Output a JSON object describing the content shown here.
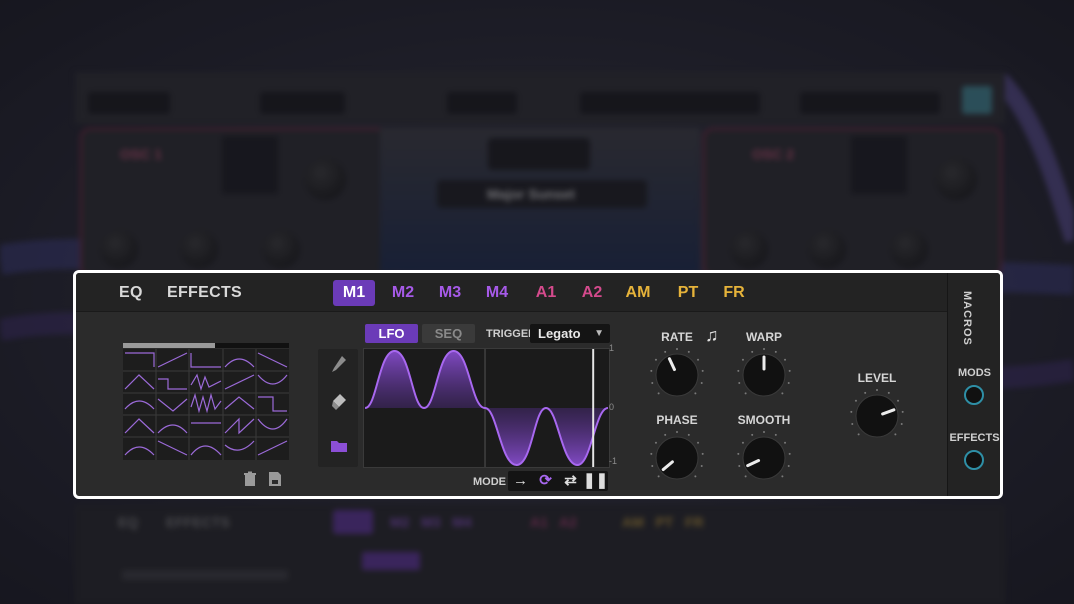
{
  "background": {
    "top_labels": [
      "Major Sunset"
    ],
    "left_panel": "OSC 1",
    "right_panel": "OSC 2"
  },
  "panel": {
    "nav": {
      "eq": "EQ",
      "effects": "EFFECTS"
    },
    "mod_tabs": [
      {
        "label": "M1",
        "color": "#ffffff",
        "active": true
      },
      {
        "label": "M2",
        "color": "#a65ae8"
      },
      {
        "label": "M3",
        "color": "#a65ae8"
      },
      {
        "label": "M4",
        "color": "#a65ae8"
      },
      {
        "label": "A1",
        "color": "#d44a8c"
      },
      {
        "label": "A2",
        "color": "#d44a8c"
      },
      {
        "label": "AM",
        "color": "#e6b33a"
      },
      {
        "label": "PT",
        "color": "#e6b33a"
      },
      {
        "label": "FR",
        "color": "#e6b33a"
      }
    ],
    "subtabs": {
      "lfo": "LFO",
      "seq": "SEQ"
    },
    "trigger": {
      "label": "TRIGGER",
      "value": "Legato"
    },
    "axis": {
      "top": "1",
      "mid": "0",
      "bottom": "-1"
    },
    "mode": {
      "label": "MODE"
    },
    "knobs": {
      "rate": "RATE",
      "warp": "WARP",
      "phase": "PHASE",
      "smooth": "SMOOTH",
      "level": "LEVEL"
    },
    "macros": {
      "title": "MACROS",
      "mods": "MODS",
      "effects": "EFFECTS"
    },
    "colors": {
      "accent": "#6b3bb8",
      "wave": "#8c4fd6",
      "knob_ring": "#2e8fa6"
    },
    "icons": [
      "pencil-icon",
      "eraser-icon",
      "folder-icon",
      "trash-icon",
      "save-icon",
      "note-icon",
      "arrow-right-icon",
      "loop-icon",
      "swap-icon",
      "pause-icon"
    ]
  }
}
